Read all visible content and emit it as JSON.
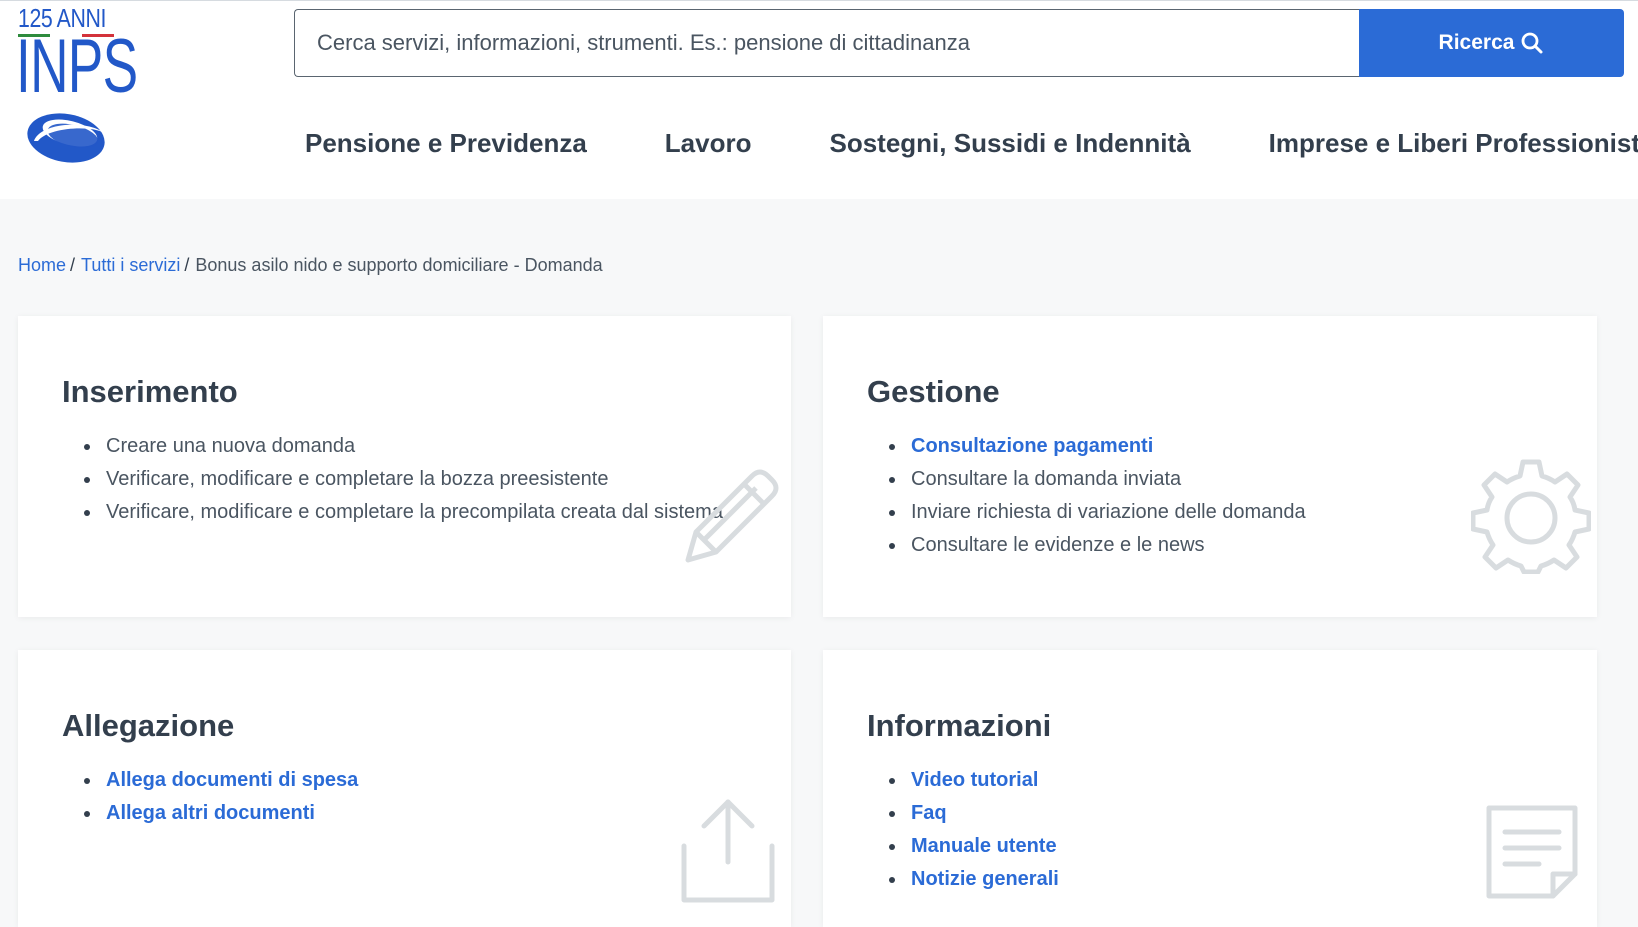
{
  "logo": {
    "anni": "125 ANNI",
    "name": "INPS",
    "flag_colors": [
      "#2e8b3d",
      "#ffffff",
      "#d3323a"
    ],
    "brand_color": "#2258c8"
  },
  "search": {
    "placeholder": "Cerca servizi, informazioni, strumenti. Es.: pensione di cittadinanza",
    "button_label": "Ricerca",
    "button_icon": "search-icon",
    "button_color": "#2b6bd6"
  },
  "nav": {
    "items": [
      {
        "label": "Pensione e Previdenza"
      },
      {
        "label": "Lavoro"
      },
      {
        "label": "Sostegni, Sussidi e Indennità"
      },
      {
        "label": "Imprese e Liberi Professionisti"
      }
    ]
  },
  "breadcrumb": {
    "home": "Home",
    "all_services": "Tutti i servizi",
    "current": "Bonus asilo nido e supporto domiciliare - Domanda",
    "separator": "/"
  },
  "cards": {
    "inserimento": {
      "title": "Inserimento",
      "icon": "pencil-icon",
      "items": [
        {
          "label": "Creare una nuova domanda"
        },
        {
          "label": "Verificare, modificare e completare la bozza preesistente"
        },
        {
          "label": "Verificare, modificare e completare la precompilata creata dal sistema"
        }
      ]
    },
    "gestione": {
      "title": "Gestione",
      "icon": "gear-icon",
      "items": [
        {
          "label": "Consultazione pagamenti"
        },
        {
          "label": "Consultare la domanda inviata"
        },
        {
          "label": "Inviare richiesta di variazione delle domanda"
        },
        {
          "label": "Consultare le evidenze e le news"
        }
      ]
    },
    "allegazione": {
      "title": "Allegazione",
      "icon": "upload-icon",
      "items": [
        {
          "label": "Allega documenti di spesa"
        },
        {
          "label": "Allega altri documenti"
        }
      ]
    },
    "informazioni": {
      "title": "Informazioni",
      "icon": "document-icon",
      "items": [
        {
          "label": "Video tutorial"
        },
        {
          "label": "Faq"
        },
        {
          "label": "Manuale utente"
        },
        {
          "label": "Notizie generali"
        }
      ]
    }
  },
  "colors": {
    "text": "#333f4d",
    "link": "#2b6bd6",
    "background": "#f7f8f9",
    "card": "#ffffff",
    "icon": "#d8dcdf"
  }
}
